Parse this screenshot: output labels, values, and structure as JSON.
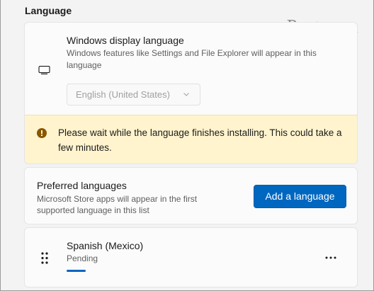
{
  "section": {
    "title": "Language"
  },
  "watermark": "groovyPost.com",
  "display_language": {
    "icon": "monitor-icon",
    "title": "Windows display language",
    "description": "Windows features like Settings and File Explorer will appear in this language",
    "selected": "English (United States)",
    "dropdown_icon": "chevron-down-icon"
  },
  "notice": {
    "icon": "warning-icon",
    "text": "Please wait while the language finishes installing. This could take a few minutes.",
    "background": "#fff4ce"
  },
  "preferred": {
    "title": "Preferred languages",
    "description": "Microsoft Store apps will appear in the first supported language in this list",
    "add_button": "Add a language"
  },
  "languages": [
    {
      "name": "Spanish (Mexico)",
      "status": "Pending",
      "progress": 0.25,
      "drag_icon": "drag-handle-icon",
      "more_icon": "more-options-icon"
    }
  ],
  "colors": {
    "accent": "#0067c0"
  }
}
